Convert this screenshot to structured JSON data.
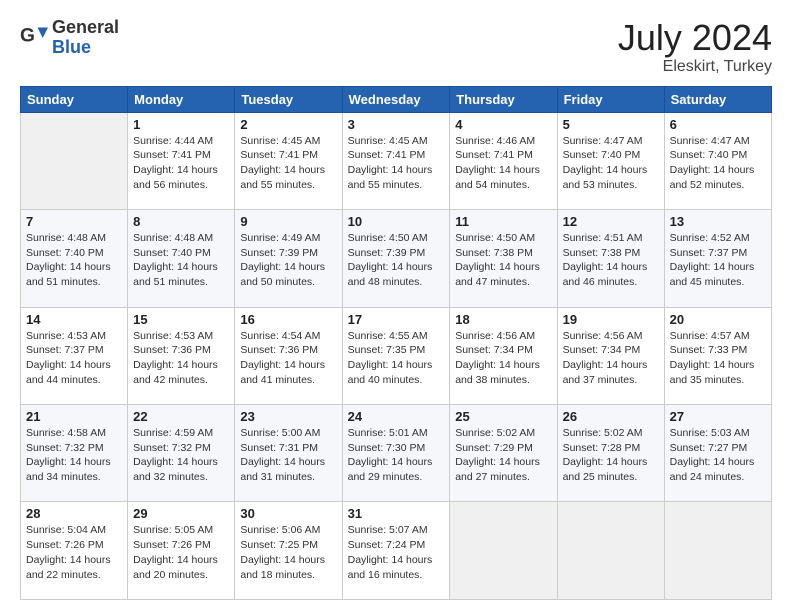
{
  "header": {
    "logo_general": "General",
    "logo_blue": "Blue",
    "title": "July 2024",
    "location": "Eleskirt, Turkey"
  },
  "weekdays": [
    "Sunday",
    "Monday",
    "Tuesday",
    "Wednesday",
    "Thursday",
    "Friday",
    "Saturday"
  ],
  "weeks": [
    [
      {
        "day": "",
        "empty": true
      },
      {
        "day": "1",
        "sunrise": "4:44 AM",
        "sunset": "7:41 PM",
        "daylight": "14 hours and 56 minutes."
      },
      {
        "day": "2",
        "sunrise": "4:45 AM",
        "sunset": "7:41 PM",
        "daylight": "14 hours and 55 minutes."
      },
      {
        "day": "3",
        "sunrise": "4:45 AM",
        "sunset": "7:41 PM",
        "daylight": "14 hours and 55 minutes."
      },
      {
        "day": "4",
        "sunrise": "4:46 AM",
        "sunset": "7:41 PM",
        "daylight": "14 hours and 54 minutes."
      },
      {
        "day": "5",
        "sunrise": "4:47 AM",
        "sunset": "7:40 PM",
        "daylight": "14 hours and 53 minutes."
      },
      {
        "day": "6",
        "sunrise": "4:47 AM",
        "sunset": "7:40 PM",
        "daylight": "14 hours and 52 minutes."
      }
    ],
    [
      {
        "day": "7",
        "sunrise": "4:48 AM",
        "sunset": "7:40 PM",
        "daylight": "14 hours and 51 minutes."
      },
      {
        "day": "8",
        "sunrise": "4:48 AM",
        "sunset": "7:40 PM",
        "daylight": "14 hours and 51 minutes."
      },
      {
        "day": "9",
        "sunrise": "4:49 AM",
        "sunset": "7:39 PM",
        "daylight": "14 hours and 50 minutes."
      },
      {
        "day": "10",
        "sunrise": "4:50 AM",
        "sunset": "7:39 PM",
        "daylight": "14 hours and 48 minutes."
      },
      {
        "day": "11",
        "sunrise": "4:50 AM",
        "sunset": "7:38 PM",
        "daylight": "14 hours and 47 minutes."
      },
      {
        "day": "12",
        "sunrise": "4:51 AM",
        "sunset": "7:38 PM",
        "daylight": "14 hours and 46 minutes."
      },
      {
        "day": "13",
        "sunrise": "4:52 AM",
        "sunset": "7:37 PM",
        "daylight": "14 hours and 45 minutes."
      }
    ],
    [
      {
        "day": "14",
        "sunrise": "4:53 AM",
        "sunset": "7:37 PM",
        "daylight": "14 hours and 44 minutes."
      },
      {
        "day": "15",
        "sunrise": "4:53 AM",
        "sunset": "7:36 PM",
        "daylight": "14 hours and 42 minutes."
      },
      {
        "day": "16",
        "sunrise": "4:54 AM",
        "sunset": "7:36 PM",
        "daylight": "14 hours and 41 minutes."
      },
      {
        "day": "17",
        "sunrise": "4:55 AM",
        "sunset": "7:35 PM",
        "daylight": "14 hours and 40 minutes."
      },
      {
        "day": "18",
        "sunrise": "4:56 AM",
        "sunset": "7:34 PM",
        "daylight": "14 hours and 38 minutes."
      },
      {
        "day": "19",
        "sunrise": "4:56 AM",
        "sunset": "7:34 PM",
        "daylight": "14 hours and 37 minutes."
      },
      {
        "day": "20",
        "sunrise": "4:57 AM",
        "sunset": "7:33 PM",
        "daylight": "14 hours and 35 minutes."
      }
    ],
    [
      {
        "day": "21",
        "sunrise": "4:58 AM",
        "sunset": "7:32 PM",
        "daylight": "14 hours and 34 minutes."
      },
      {
        "day": "22",
        "sunrise": "4:59 AM",
        "sunset": "7:32 PM",
        "daylight": "14 hours and 32 minutes."
      },
      {
        "day": "23",
        "sunrise": "5:00 AM",
        "sunset": "7:31 PM",
        "daylight": "14 hours and 31 minutes."
      },
      {
        "day": "24",
        "sunrise": "5:01 AM",
        "sunset": "7:30 PM",
        "daylight": "14 hours and 29 minutes."
      },
      {
        "day": "25",
        "sunrise": "5:02 AM",
        "sunset": "7:29 PM",
        "daylight": "14 hours and 27 minutes."
      },
      {
        "day": "26",
        "sunrise": "5:02 AM",
        "sunset": "7:28 PM",
        "daylight": "14 hours and 25 minutes."
      },
      {
        "day": "27",
        "sunrise": "5:03 AM",
        "sunset": "7:27 PM",
        "daylight": "14 hours and 24 minutes."
      }
    ],
    [
      {
        "day": "28",
        "sunrise": "5:04 AM",
        "sunset": "7:26 PM",
        "daylight": "14 hours and 22 minutes."
      },
      {
        "day": "29",
        "sunrise": "5:05 AM",
        "sunset": "7:26 PM",
        "daylight": "14 hours and 20 minutes."
      },
      {
        "day": "30",
        "sunrise": "5:06 AM",
        "sunset": "7:25 PM",
        "daylight": "14 hours and 18 minutes."
      },
      {
        "day": "31",
        "sunrise": "5:07 AM",
        "sunset": "7:24 PM",
        "daylight": "14 hours and 16 minutes."
      },
      {
        "day": "",
        "empty": true
      },
      {
        "day": "",
        "empty": true
      },
      {
        "day": "",
        "empty": true
      }
    ]
  ]
}
